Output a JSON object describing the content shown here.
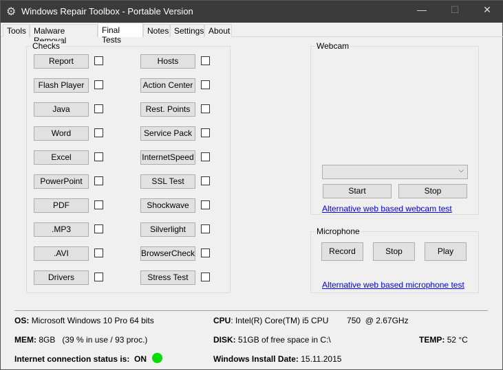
{
  "window": {
    "title": "Windows Repair Toolbox - Portable Version",
    "minimize": "—",
    "maximize": "☐",
    "close": "✕"
  },
  "tabs": [
    "Tools",
    "Malware Removal",
    "Final Tests",
    "Notes",
    "Settings",
    "About"
  ],
  "active_tab": "Final Tests",
  "checks": {
    "label": "Checks",
    "left": [
      "Report",
      "Flash Player",
      "Java",
      "Word",
      "Excel",
      "PowerPoint",
      "PDF",
      ".MP3",
      ".AVI",
      "Drivers"
    ],
    "right": [
      "Hosts",
      "Action Center",
      "Rest. Points",
      "Service Pack",
      "InternetSpeed",
      "SSL Test",
      "Shockwave",
      "Silverlight",
      "BrowserCheck",
      "Stress Test"
    ]
  },
  "webcam": {
    "label": "Webcam",
    "dropdown_value": "",
    "start": "Start",
    "stop": "Stop",
    "link": "Alternative web based webcam test"
  },
  "microphone": {
    "label": "Microphone",
    "record": "Record",
    "stop": "Stop",
    "play": "Play",
    "link": "Alternative web based microphone test"
  },
  "info": {
    "os_label": "OS:",
    "os": "Microsoft Windows 10 Pro 64 bits",
    "cpu_label": "CPU",
    "cpu": ": Intel(R) Core(TM) i5 CPU        750  @ 2.67GHz",
    "mem_label": "MEM:",
    "mem": "8GB   (39 % in use / 93 proc.)",
    "disk_label": "DISK:",
    "disk": "51GB of free space in C:\\",
    "temp_label": "TEMP:",
    "temp": "52 °C",
    "internet_label": "Internet connection status is:  ON",
    "internet_color": "#00e000",
    "install_label": "Windows Install Date:",
    "install": "15.11.2015"
  }
}
